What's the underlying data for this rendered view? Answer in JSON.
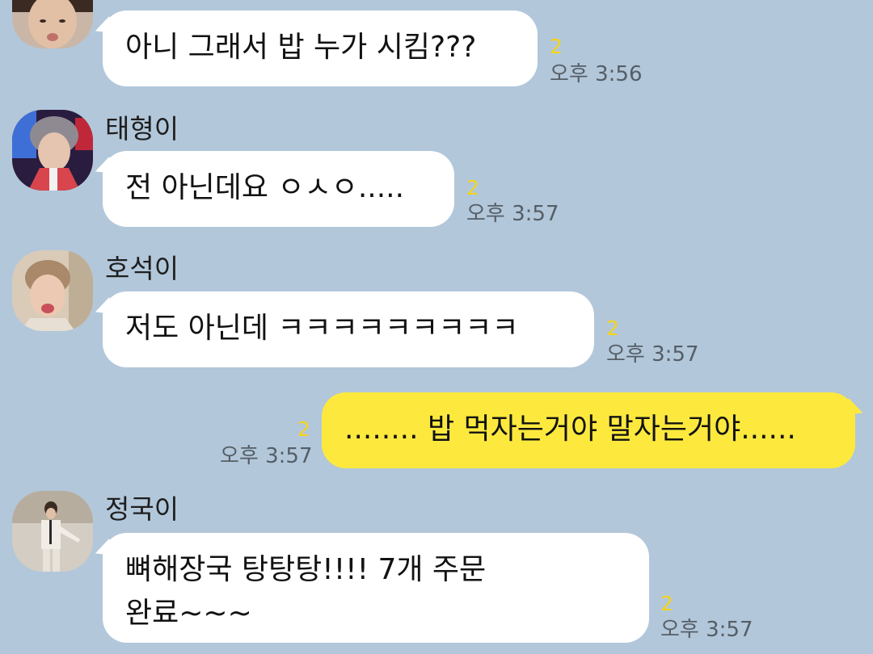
{
  "messages": [
    {
      "sender": "",
      "avatar": "avatar-jin",
      "direction": "in",
      "lines": [
        "아니 그래서 밥 누가 시킴???"
      ],
      "unread": "2",
      "time": "오후 3:56"
    },
    {
      "sender": "태형이",
      "avatar": "avatar-taehyung",
      "direction": "in",
      "lines": [
        "전 아닌데요 ㅇㅅㅇ....."
      ],
      "unread": "2",
      "time": "오후 3:57"
    },
    {
      "sender": "호석이",
      "avatar": "avatar-hoseok",
      "direction": "in",
      "lines": [
        "저도 아닌데 ㅋㅋㅋㅋㅋㅋㅋㅋㅋ"
      ],
      "unread": "2",
      "time": "오후 3:57"
    },
    {
      "sender": "",
      "avatar": "",
      "direction": "out",
      "lines": [
        "........ 밥 먹자는거야 말자는거야......"
      ],
      "unread": "2",
      "time": "오후 3:57"
    },
    {
      "sender": "정국이",
      "avatar": "avatar-jungkook",
      "direction": "in",
      "lines": [
        "뼈해장국 탕탕탕!!!! 7개 주문",
        "완료~~~"
      ],
      "unread": "2",
      "time": "오후 3:57"
    }
  ],
  "colors": {
    "background": "#b2c7da",
    "incoming_bubble": "#ffffff",
    "outgoing_bubble": "#fde93e",
    "unread": "#f5d41a",
    "time": "#555e66"
  }
}
